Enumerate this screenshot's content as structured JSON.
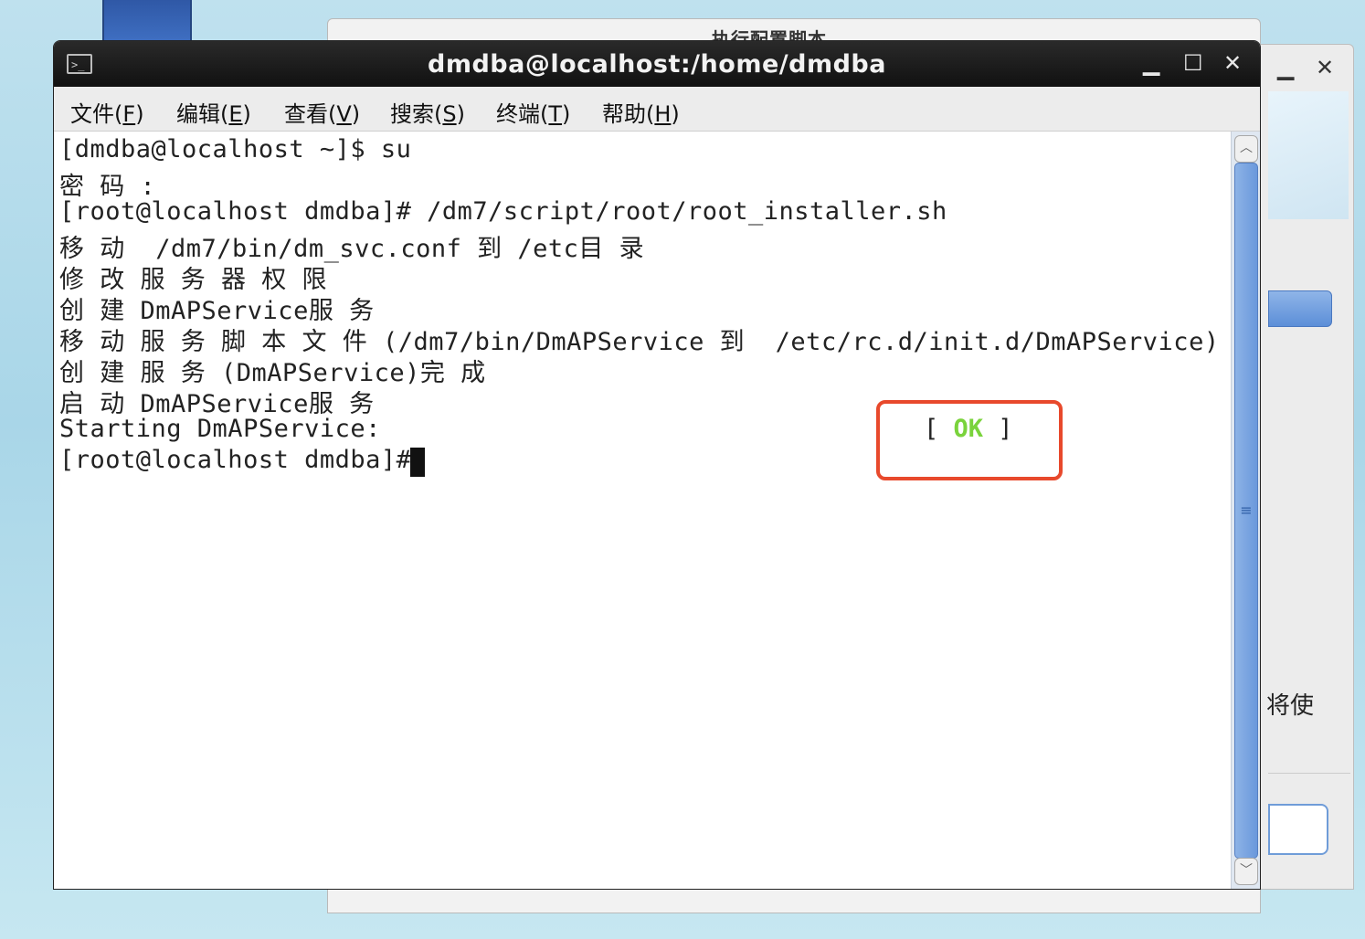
{
  "background_window": {
    "title": "执行配置脚本"
  },
  "background_side": {
    "text_fragment": "将使"
  },
  "terminal": {
    "title": "dmdba@localhost:/home/dmdba",
    "controls": {
      "minimize": "▁",
      "maximize": "☐",
      "close": "✕"
    },
    "menu": [
      {
        "label": "文件(",
        "key": "F",
        "end": ")"
      },
      {
        "label": "编辑(",
        "key": "E",
        "end": ")"
      },
      {
        "label": "查看(",
        "key": "V",
        "end": ")"
      },
      {
        "label": "搜索(",
        "key": "S",
        "end": ")"
      },
      {
        "label": "终端(",
        "key": "T",
        "end": ")"
      },
      {
        "label": "帮助(",
        "key": "H",
        "end": ")"
      }
    ],
    "lines": [
      "[dmdba@localhost ~]$ su",
      "密 码 :",
      "[root@localhost dmdba]# /dm7/script/root/root_installer.sh",
      "移 动  /dm7/bin/dm_svc.conf 到 /etc目 录",
      "修 改 服 务 器 权 限",
      "创 建 DmAPService服 务",
      "移 动 服 务 脚 本 文 件 (/dm7/bin/DmAPService 到  /etc/rc.d/init.d/DmAPService)",
      "创 建 服 务 (DmAPService)完 成",
      "启 动 DmAPService服 务",
      "Starting DmAPService:",
      "[root@localhost dmdba]#"
    ],
    "ok_status": {
      "open": "[ ",
      "word": "OK",
      "close": " ]"
    }
  }
}
